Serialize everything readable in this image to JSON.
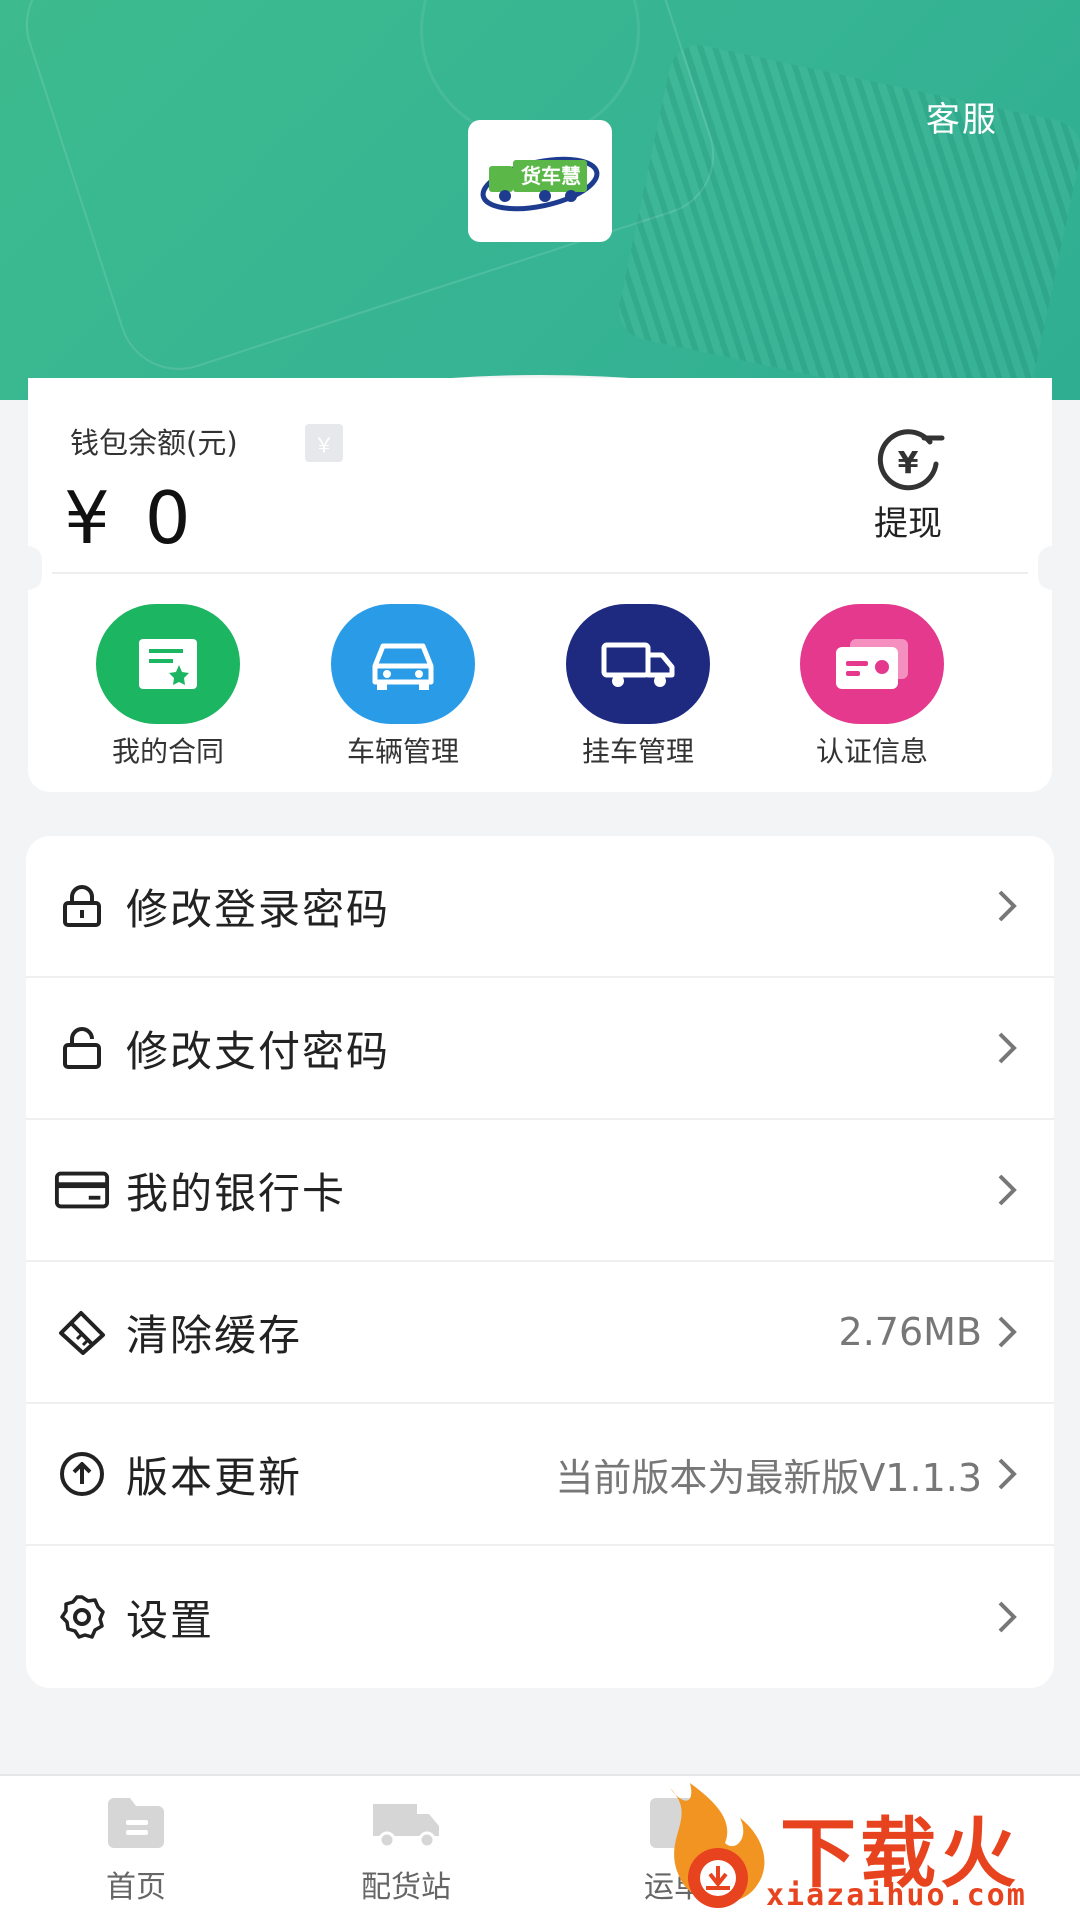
{
  "header": {
    "service_label": "客服",
    "logo_text": "货车慧",
    "bg_color": "#3dbb8e"
  },
  "wallet": {
    "balance_label": "钱包余额(元)",
    "badge": "￥",
    "balance_value": "¥ 0",
    "withdraw_symbol": "¥",
    "withdraw_label": "提现"
  },
  "quick_actions": [
    {
      "label": "我的合同",
      "icon": "contract-icon",
      "color": "#1cb561"
    },
    {
      "label": "车辆管理",
      "icon": "car-icon",
      "color": "#2a9be6"
    },
    {
      "label": "挂车管理",
      "icon": "truck-icon",
      "color": "#1d2a80"
    },
    {
      "label": "认证信息",
      "icon": "id-card-icon",
      "color": "#e4398c"
    }
  ],
  "menu": [
    {
      "label": "修改登录密码",
      "value": "",
      "icon": "lock-icon"
    },
    {
      "label": "修改支付密码",
      "value": "",
      "icon": "unlock-icon"
    },
    {
      "label": "我的银行卡",
      "value": "",
      "icon": "bank-card-icon"
    },
    {
      "label": "清除缓存",
      "value": "2.76MB",
      "icon": "eraser-icon"
    },
    {
      "label": "版本更新",
      "value": "当前版本为最新版V1.1.3",
      "icon": "upgrade-icon"
    },
    {
      "label": "设置",
      "value": "",
      "icon": "gear-icon"
    }
  ],
  "bottom_nav": [
    {
      "label": "首页",
      "icon": "home-icon"
    },
    {
      "label": "配货站",
      "icon": "dispatch-icon"
    },
    {
      "label": "运单",
      "icon": "waybill-icon"
    }
  ],
  "watermark": {
    "text": "下载火",
    "url": "xiazaihuo.com"
  }
}
